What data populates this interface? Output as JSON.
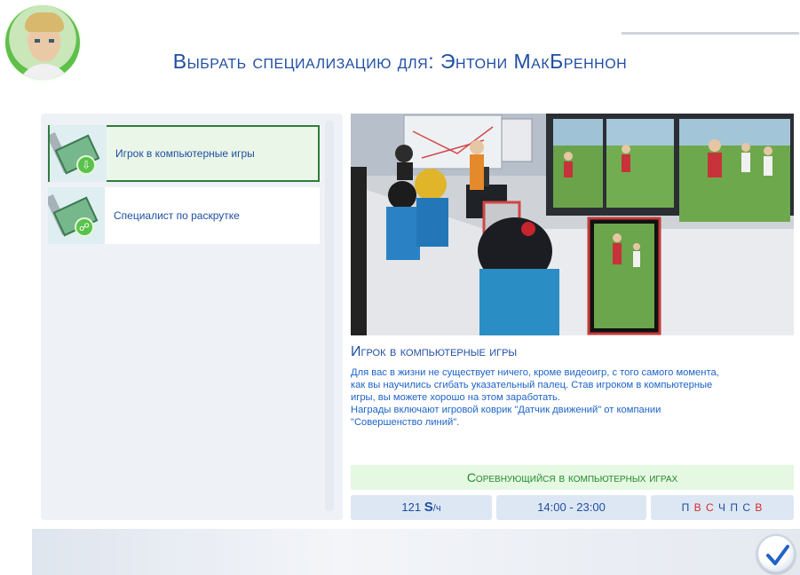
{
  "dialog": {
    "title": "Выбрать специализацию для: Энтони МакБреннон"
  },
  "careers": [
    {
      "label": "Игрок в компьютерные игры",
      "selected": true,
      "icon": "graphics-card-icon"
    },
    {
      "label": "Специалист по раскрутке",
      "selected": false,
      "icon": "graphics-card-icon"
    }
  ],
  "detail": {
    "title": "Игрок в компьютерные игры",
    "description_lines": [
      "Для вас в жизни не существует ничего, кроме видеоигр, с того самого момента,",
      "как вы научились сгибать указательный палец. Став игроком в компьютерные",
      "игры, вы можете хорошо на этом заработать.",
      "Награды включают игровой коврик \"Датчик движений\" от компании",
      "\"Совершенство линий\"."
    ],
    "first_level": "Соревнующийся в компьютерных играх",
    "pay_amount": "121",
    "pay_currency": "S",
    "pay_unit": "/ч",
    "hours": "14:00 - 23:00",
    "days": [
      {
        "letter": "П",
        "work": false
      },
      {
        "letter": "В",
        "work": true
      },
      {
        "letter": "С",
        "work": true
      },
      {
        "letter": "Ч",
        "work": false
      },
      {
        "letter": "П",
        "work": false
      },
      {
        "letter": "С",
        "work": false
      },
      {
        "letter": "В",
        "work": true
      }
    ]
  },
  "colors": {
    "accent": "#1f4ea3",
    "selected_border": "#2f7d3a",
    "work_day": "#d32a2a"
  },
  "icons": {
    "confirm": "checkmark-icon",
    "avatar": "sim-portrait"
  }
}
